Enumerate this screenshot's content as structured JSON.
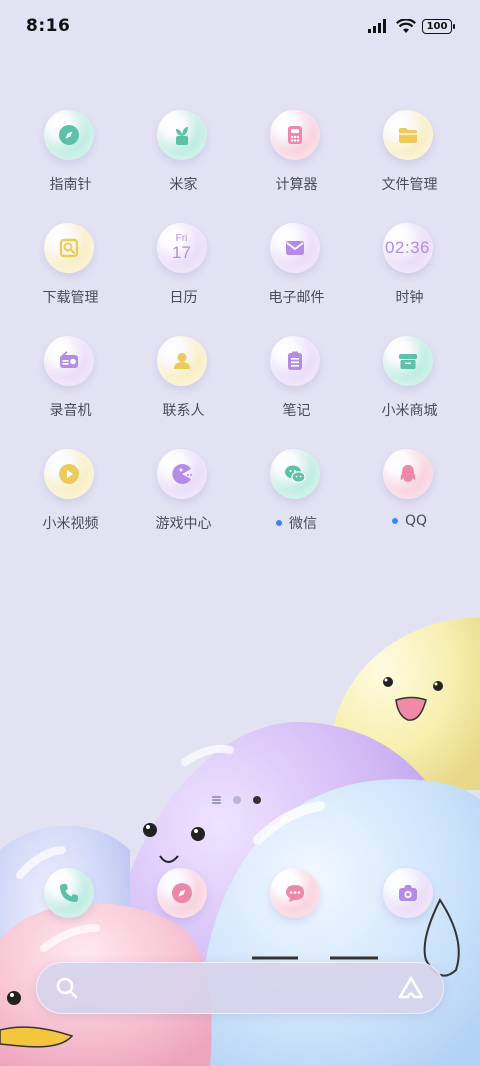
{
  "status_bar": {
    "time": "8:16",
    "battery": "100"
  },
  "apps": [
    {
      "label": "指南针",
      "icon": "compass-icon",
      "c1": "#a8e6d7",
      "c2": "#7fd3c1",
      "glyph_color": "#5cc1a7",
      "dot": false
    },
    {
      "label": "米家",
      "icon": "mijia-plant-icon",
      "c1": "#a8e6d7",
      "c2": "#7fd3c1",
      "glyph_color": "#5cc1a7",
      "dot": false
    },
    {
      "label": "计算器",
      "icon": "calculator-icon",
      "c1": "#f7c3d3",
      "c2": "#f29bb6",
      "glyph_color": "#ee88a8",
      "dot": false
    },
    {
      "label": "文件管理",
      "icon": "folder-icon",
      "c1": "#f7eab0",
      "c2": "#f2dc86",
      "glyph_color": "#ecca5d",
      "dot": false
    },
    {
      "label": "下载管理",
      "icon": "download-icon",
      "c1": "#f7eab0",
      "c2": "#f2dc86",
      "glyph_color": "#ecca5d",
      "dot": false
    },
    {
      "label": "日历",
      "icon": "calendar-icon",
      "c1": "#e3d1f7",
      "c2": "#cfb2f2",
      "glyph_color": "#b58be8",
      "dot": false,
      "day": "Fri",
      "date": "17"
    },
    {
      "label": "电子邮件",
      "icon": "mail-icon",
      "c1": "#e3d1f7",
      "c2": "#cfb2f2",
      "glyph_color": "#b58be8",
      "dot": false
    },
    {
      "label": "时钟",
      "icon": "clock-icon",
      "c1": "#e3d1f7",
      "c2": "#cfb2f2",
      "glyph_color": "#b58be8",
      "dot": false,
      "clock": "02:36"
    },
    {
      "label": "录音机",
      "icon": "recorder-icon",
      "c1": "#e3d1f7",
      "c2": "#cfb2f2",
      "glyph_color": "#b58be8",
      "dot": false
    },
    {
      "label": "联系人",
      "icon": "contacts-icon",
      "c1": "#f7eab0",
      "c2": "#f2dc86",
      "glyph_color": "#ecca5d",
      "dot": false
    },
    {
      "label": "笔记",
      "icon": "notes-icon",
      "c1": "#e3d1f7",
      "c2": "#cfb2f2",
      "glyph_color": "#b58be8",
      "dot": false
    },
    {
      "label": "小米商城",
      "icon": "store-icon",
      "c1": "#a8e6d7",
      "c2": "#7fd3c1",
      "glyph_color": "#5cc1a7",
      "dot": false
    },
    {
      "label": "小米视频",
      "icon": "video-play-icon",
      "c1": "#f7eab0",
      "c2": "#f2dc86",
      "glyph_color": "#ecca5d",
      "dot": false
    },
    {
      "label": "游戏中心",
      "icon": "game-center-icon",
      "c1": "#e3d1f7",
      "c2": "#cfb2f2",
      "glyph_color": "#b58be8",
      "dot": false
    },
    {
      "label": "微信",
      "icon": "wechat-icon",
      "c1": "#a8e6d7",
      "c2": "#7fd3c1",
      "glyph_color": "#5cc1a7",
      "dot": true
    },
    {
      "label": "QQ",
      "icon": "qq-penguin-icon",
      "c1": "#f7c3d3",
      "c2": "#f29bb6",
      "glyph_color": "#ee88a8",
      "dot": true
    }
  ],
  "dock": [
    {
      "icon": "phone-icon",
      "c1": "#a8e6d7",
      "c2": "#7fd3c1",
      "glyph_color": "#5cc1a7"
    },
    {
      "icon": "browser-compass-icon",
      "c1": "#f7c3d3",
      "c2": "#f29bb6",
      "glyph_color": "#ee88a8"
    },
    {
      "icon": "messages-icon",
      "c1": "#f7c3d3",
      "c2": "#f29bb6",
      "glyph_color": "#ee88a8"
    },
    {
      "icon": "camera-icon",
      "c1": "#e3d1f7",
      "c2": "#cfb2f2",
      "glyph_color": "#b58be8"
    }
  ],
  "page_indicator": {
    "pages": 3,
    "active": 2
  },
  "search_bar": {
    "left_icon": "search-icon",
    "right_icon": "assistant-icon"
  }
}
